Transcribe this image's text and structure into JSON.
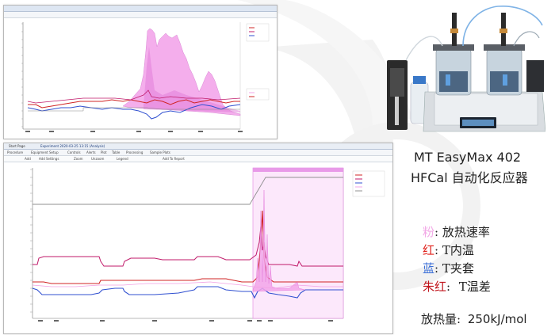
{
  "top_window": {
    "title_bar_text": "",
    "tool_labels": []
  },
  "bottom_window": {
    "tabs": [
      "Start Page",
      "Experiment 2020-03-25 13:15 (Analysis)"
    ],
    "menu": [
      "Procedure",
      "Equipment Setup",
      "Controls",
      "Alerts",
      "Plot",
      "Table",
      "Processing",
      "Sample Plots"
    ],
    "toolbar": [
      "Add",
      "Add Settings",
      "Zoom",
      "Unzoom",
      "Legend",
      "Add To Report"
    ]
  },
  "device": {
    "title": "MT EasyMax 402",
    "subtitle": "HFCal 自动化反应器"
  },
  "legend": [
    {
      "key": "粉",
      "sep": ":",
      "value": "放热速率",
      "color": "#f2a8e6"
    },
    {
      "key": "红",
      "sep": ":",
      "value": "T内温",
      "color": "#e0201a"
    },
    {
      "key": "蓝",
      "sep": ":",
      "value": "T夹套",
      "color": "#3b6fd8"
    },
    {
      "key": "朱红",
      "sep": ":",
      "value": "T温差",
      "color": "#c0141c"
    }
  ],
  "heat_label": "放热量:",
  "heat_value": "250kJ/mol",
  "colors": {
    "pink_fill": "#f3a6ea",
    "red_line": "#d02424",
    "blue_line": "#3050d0",
    "magenta_line": "#c01a6a",
    "gray_line": "#909090"
  }
}
